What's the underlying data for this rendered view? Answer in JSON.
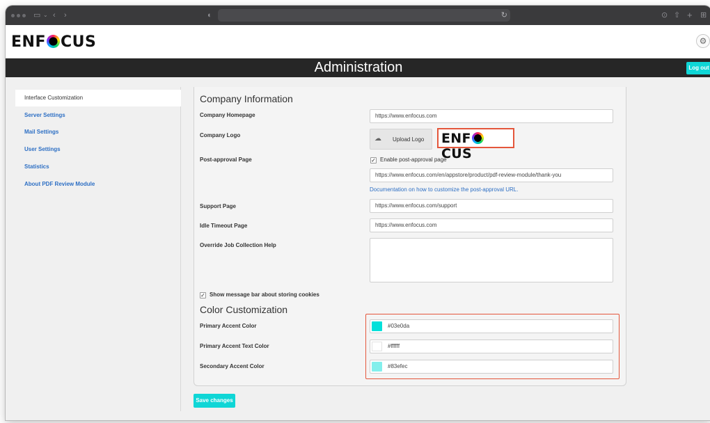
{
  "browser": {
    "icons": [
      "window-dots",
      "sidebar-icon",
      "back-icon",
      "forward-icon",
      "shield-icon",
      "reload-icon",
      "download-icon",
      "share-icon",
      "new-tab-icon",
      "tabs-icon"
    ]
  },
  "header": {
    "logo_text_before": "ENF",
    "logo_text_after": "CUS",
    "gear_symbol": "⚙"
  },
  "title_bar": {
    "title": "Administration",
    "logout_label": "Log out"
  },
  "sidebar": {
    "items": [
      {
        "label": "Interface Customization",
        "active": true
      },
      {
        "label": "Server Settings",
        "active": false
      },
      {
        "label": "Mail Settings",
        "active": false
      },
      {
        "label": "User Settings",
        "active": false
      },
      {
        "label": "Statistics",
        "active": false
      },
      {
        "label": "About PDF Review Module",
        "active": false
      }
    ]
  },
  "company": {
    "section_title": "Company Information",
    "homepage_label": "Company Homepage",
    "homepage_value": "https://www.enfocus.com",
    "logo_label": "Company Logo",
    "upload_label": "Upload Logo",
    "post_approval_label": "Post-approval Page",
    "enable_post_approval_label": "Enable post-approval page",
    "enable_post_approval_checked": true,
    "post_approval_value": "https://www.enfocus.com/en/appstore/product/pdf-review-module/thank-you",
    "doc_link": "Documentation on how to customize the post-approval URL.",
    "support_label": "Support Page",
    "support_value": "https://www.enfocus.com/support",
    "idle_label": "Idle Timeout Page",
    "idle_value": "https://www.enfocus.com",
    "override_label": "Override Job Collection Help",
    "override_value": "",
    "cookies_label": "Show message bar about storing cookies",
    "cookies_checked": true
  },
  "colors": {
    "section_title": "Color Customization",
    "primary_label": "Primary Accent Color",
    "primary_value": "#03e0da",
    "primary_text_label": "Primary Accent Text Color",
    "primary_text_value": "#ffffff",
    "secondary_label": "Secondary Accent Color",
    "secondary_value": "#83efec",
    "highlight_color": "#e4563b"
  },
  "actions": {
    "save_label": "Save changes"
  },
  "checkmark": "✓"
}
